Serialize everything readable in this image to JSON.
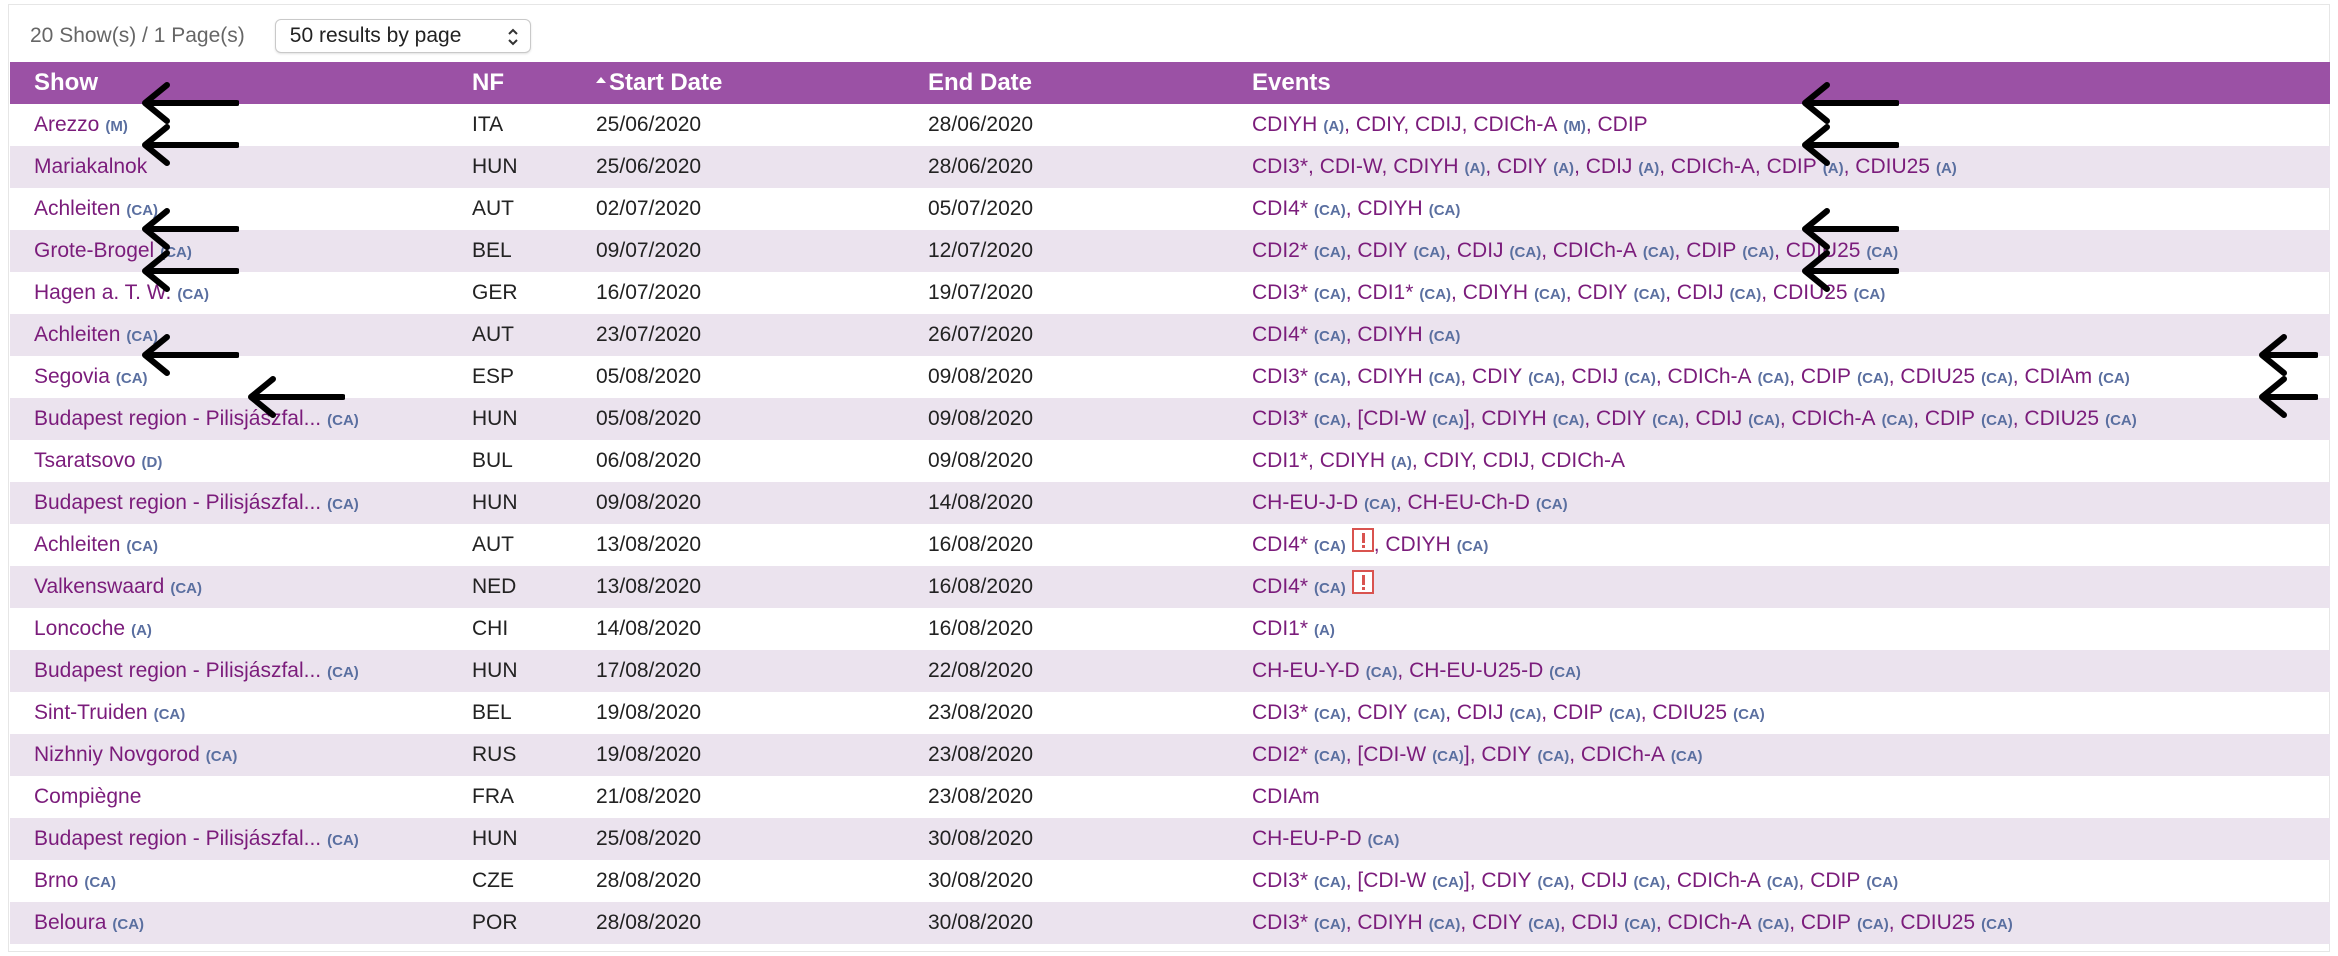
{
  "pagination": {
    "summary": "20 Show(s) / 1 Page(s)",
    "per_page": "50 results by page"
  },
  "columns": {
    "show": "Show",
    "nf": "NF",
    "start": "Start Date",
    "end": "End Date",
    "events": "Events"
  },
  "rows": [
    {
      "show": "Arezzo",
      "badge": "(M)",
      "nf": "ITA",
      "start": "25/06/2020",
      "end": "28/06/2020",
      "events": [
        {
          "t": "CDIYH",
          "b": "(A)"
        },
        {
          "t": "CDIY"
        },
        {
          "t": "CDIJ"
        },
        {
          "t": "CDICh-A",
          "b": "(M)"
        },
        {
          "t": "CDIP"
        }
      ]
    },
    {
      "show": "Mariakalnok",
      "badge": "",
      "nf": "HUN",
      "start": "25/06/2020",
      "end": "28/06/2020",
      "events": [
        {
          "t": "CDI3*"
        },
        {
          "t": "CDI-W"
        },
        {
          "t": "CDIYH",
          "b": "(A)"
        },
        {
          "t": "CDIY",
          "b": "(A)"
        },
        {
          "t": "CDIJ",
          "b": "(A)"
        },
        {
          "t": "CDICh-A"
        },
        {
          "t": "CDIP",
          "b": "(A)"
        },
        {
          "t": "CDIU25",
          "b": "(A)"
        }
      ]
    },
    {
      "show": "Achleiten",
      "badge": "(CA)",
      "nf": "AUT",
      "start": "02/07/2020",
      "end": "05/07/2020",
      "events": [
        {
          "t": "CDI4*",
          "b": "(CA)"
        },
        {
          "t": "CDIYH",
          "b": "(CA)"
        }
      ]
    },
    {
      "show": "Grote-Brogel",
      "badge": "(CA)",
      "nf": "BEL",
      "start": "09/07/2020",
      "end": "12/07/2020",
      "events": [
        {
          "t": "CDI2*",
          "b": "(CA)"
        },
        {
          "t": "CDIY",
          "b": "(CA)"
        },
        {
          "t": "CDIJ",
          "b": "(CA)"
        },
        {
          "t": "CDICh-A",
          "b": "(CA)"
        },
        {
          "t": "CDIP",
          "b": "(CA)"
        },
        {
          "t": "CDIU25",
          "b": "(CA)"
        }
      ]
    },
    {
      "show": "Hagen a. T. W.",
      "badge": "(CA)",
      "nf": "GER",
      "start": "16/07/2020",
      "end": "19/07/2020",
      "events": [
        {
          "t": "CDI3*",
          "b": "(CA)"
        },
        {
          "t": "CDI1*",
          "b": "(CA)"
        },
        {
          "t": "CDIYH",
          "b": "(CA)"
        },
        {
          "t": "CDIY",
          "b": "(CA)"
        },
        {
          "t": "CDIJ",
          "b": "(CA)"
        },
        {
          "t": "CDIU25",
          "b": "(CA)"
        }
      ]
    },
    {
      "show": "Achleiten",
      "badge": "(CA)",
      "nf": "AUT",
      "start": "23/07/2020",
      "end": "26/07/2020",
      "events": [
        {
          "t": "CDI4*",
          "b": "(CA)"
        },
        {
          "t": "CDIYH",
          "b": "(CA)"
        }
      ]
    },
    {
      "show": "Segovia",
      "badge": "(CA)",
      "nf": "ESP",
      "start": "05/08/2020",
      "end": "09/08/2020",
      "events": [
        {
          "t": "CDI3*",
          "b": "(CA)"
        },
        {
          "t": "CDIYH",
          "b": "(CA)"
        },
        {
          "t": "CDIY",
          "b": "(CA)"
        },
        {
          "t": "CDIJ",
          "b": "(CA)"
        },
        {
          "t": "CDICh-A",
          "b": "(CA)"
        },
        {
          "t": "CDIP",
          "b": "(CA)"
        },
        {
          "t": "CDIU25",
          "b": "(CA)"
        },
        {
          "t": "CDIAm",
          "b": "(CA)"
        }
      ]
    },
    {
      "show": "Budapest region - Pilisjászfal...",
      "badge": "(CA)",
      "nf": "HUN",
      "start": "05/08/2020",
      "end": "09/08/2020",
      "events": [
        {
          "t": "CDI3*",
          "b": "(CA)"
        },
        {
          "t": "[CDI-W",
          "b": "(CA)",
          "close": "]"
        },
        {
          "t": "CDIYH",
          "b": "(CA)"
        },
        {
          "t": "CDIY",
          "b": "(CA)"
        },
        {
          "t": "CDIJ",
          "b": "(CA)"
        },
        {
          "t": "CDICh-A",
          "b": "(CA)"
        },
        {
          "t": "CDIP",
          "b": "(CA)"
        },
        {
          "t": "CDIU25",
          "b": "(CA)"
        }
      ]
    },
    {
      "show": "Tsaratsovo",
      "badge": "(D)",
      "nf": "BUL",
      "start": "06/08/2020",
      "end": "09/08/2020",
      "events": [
        {
          "t": "CDI1*"
        },
        {
          "t": "CDIYH",
          "b": "(A)"
        },
        {
          "t": "CDIY"
        },
        {
          "t": "CDIJ"
        },
        {
          "t": "CDICh-A"
        }
      ]
    },
    {
      "show": "Budapest region - Pilisjászfal...",
      "badge": "(CA)",
      "nf": "HUN",
      "start": "09/08/2020",
      "end": "14/08/2020",
      "events": [
        {
          "t": "CH-EU-J-D",
          "b": "(CA)"
        },
        {
          "t": "CH-EU-Ch-D",
          "b": "(CA)"
        }
      ]
    },
    {
      "show": "Achleiten",
      "badge": "(CA)",
      "nf": "AUT",
      "start": "13/08/2020",
      "end": "16/08/2020",
      "events": [
        {
          "t": "CDI4*",
          "b": "(CA)",
          "warn": true
        },
        {
          "t": "CDIYH",
          "b": "(CA)"
        }
      ]
    },
    {
      "show": "Valkenswaard",
      "badge": "(CA)",
      "nf": "NED",
      "start": "13/08/2020",
      "end": "16/08/2020",
      "events": [
        {
          "t": "CDI4*",
          "b": "(CA)",
          "warn": true
        }
      ]
    },
    {
      "show": "Loncoche",
      "badge": "(A)",
      "nf": "CHI",
      "start": "14/08/2020",
      "end": "16/08/2020",
      "events": [
        {
          "t": "CDI1*",
          "b": "(A)"
        }
      ]
    },
    {
      "show": "Budapest region - Pilisjászfal...",
      "badge": "(CA)",
      "nf": "HUN",
      "start": "17/08/2020",
      "end": "22/08/2020",
      "events": [
        {
          "t": "CH-EU-Y-D",
          "b": "(CA)"
        },
        {
          "t": "CH-EU-U25-D",
          "b": "(CA)"
        }
      ]
    },
    {
      "show": "Sint-Truiden",
      "badge": "(CA)",
      "nf": "BEL",
      "start": "19/08/2020",
      "end": "23/08/2020",
      "events": [
        {
          "t": "CDI3*",
          "b": "(CA)"
        },
        {
          "t": "CDIY",
          "b": "(CA)"
        },
        {
          "t": "CDIJ",
          "b": "(CA)"
        },
        {
          "t": "CDIP",
          "b": "(CA)"
        },
        {
          "t": "CDIU25",
          "b": "(CA)"
        }
      ]
    },
    {
      "show": "Nizhniy Novgorod",
      "badge": "(CA)",
      "nf": "RUS",
      "start": "19/08/2020",
      "end": "23/08/2020",
      "events": [
        {
          "t": "CDI2*",
          "b": "(CA)"
        },
        {
          "t": "[CDI-W",
          "b": "(CA)",
          "close": "]"
        },
        {
          "t": "CDIY",
          "b": "(CA)"
        },
        {
          "t": "CDICh-A",
          "b": "(CA)"
        }
      ]
    },
    {
      "show": "Compiègne",
      "badge": "",
      "nf": "FRA",
      "start": "21/08/2020",
      "end": "23/08/2020",
      "events": [
        {
          "t": "CDIAm"
        }
      ]
    },
    {
      "show": "Budapest region - Pilisjászfal...",
      "badge": "(CA)",
      "nf": "HUN",
      "start": "25/08/2020",
      "end": "30/08/2020",
      "events": [
        {
          "t": "CH-EU-P-D",
          "b": "(CA)"
        }
      ]
    },
    {
      "show": "Brno",
      "badge": "(CA)",
      "nf": "CZE",
      "start": "28/08/2020",
      "end": "30/08/2020",
      "events": [
        {
          "t": "CDI3*",
          "b": "(CA)"
        },
        {
          "t": "[CDI-W",
          "b": "(CA)",
          "close": "]"
        },
        {
          "t": "CDIY",
          "b": "(CA)"
        },
        {
          "t": "CDIJ",
          "b": "(CA)"
        },
        {
          "t": "CDICh-A",
          "b": "(CA)"
        },
        {
          "t": "CDIP",
          "b": "(CA)"
        }
      ]
    },
    {
      "show": "Beloura",
      "badge": "(CA)",
      "nf": "POR",
      "start": "28/08/2020",
      "end": "30/08/2020",
      "events": [
        {
          "t": "CDI3*",
          "b": "(CA)"
        },
        {
          "t": "CDIYH",
          "b": "(CA)"
        },
        {
          "t": "CDIY",
          "b": "(CA)"
        },
        {
          "t": "CDIJ",
          "b": "(CA)"
        },
        {
          "t": "CDICh-A",
          "b": "(CA)"
        },
        {
          "t": "CDIP",
          "b": "(CA)"
        },
        {
          "t": "CDIU25",
          "b": "(CA)"
        }
      ]
    }
  ],
  "annotation_arrows": [
    {
      "row": 0,
      "col": "show"
    },
    {
      "row": 0,
      "col": "events"
    },
    {
      "row": 1,
      "col": "show"
    },
    {
      "row": 1,
      "col": "events"
    },
    {
      "row": 3,
      "col": "show"
    },
    {
      "row": 3,
      "col": "events"
    },
    {
      "row": 4,
      "col": "show"
    },
    {
      "row": 4,
      "col": "events"
    },
    {
      "row": 6,
      "col": "show"
    },
    {
      "row": 6,
      "col": "events-edge"
    },
    {
      "row": 7,
      "col": "show-far"
    },
    {
      "row": 7,
      "col": "events-edge"
    }
  ]
}
